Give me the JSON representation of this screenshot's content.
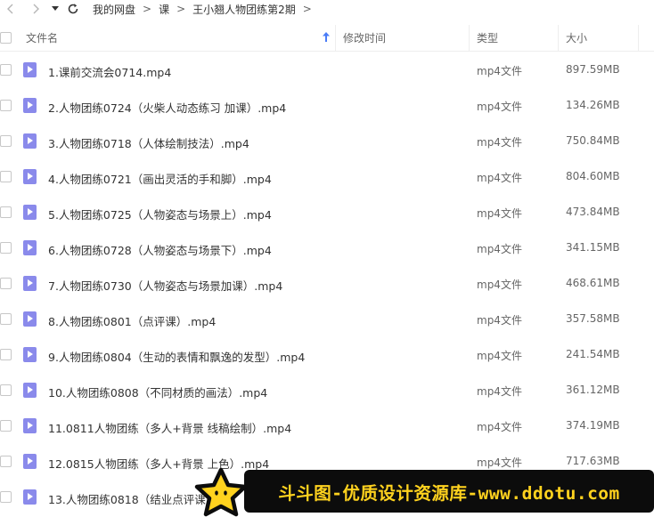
{
  "nav": {
    "back_icon": "chevron-left-icon",
    "forward_icon": "chevron-right-icon",
    "dropdown_icon": "caret-down-icon",
    "refresh_icon": "refresh-icon"
  },
  "breadcrumb": {
    "items": [
      "我的网盘",
      "课",
      "王小翘人物团练第2期"
    ],
    "separator": ">"
  },
  "table": {
    "headers": {
      "name": "文件名",
      "modified": "修改时间",
      "type": "类型",
      "size": "大小"
    },
    "sort_icon": "arrow-up-icon",
    "sort_color": "#4a7cf7",
    "file_icon_color": "#8a8aeb",
    "rows": [
      {
        "name": "1.课前交流会0714.mp4",
        "type": "mp4文件",
        "size": "897.59MB"
      },
      {
        "name": "2.人物团练0724（火柴人动态练习 加课）.mp4",
        "type": "mp4文件",
        "size": "134.26MB"
      },
      {
        "name": "3.人物团练0718（人体绘制技法）.mp4",
        "type": "mp4文件",
        "size": "750.84MB"
      },
      {
        "name": "4.人物团练0721（画出灵活的手和脚）.mp4",
        "type": "mp4文件",
        "size": "804.60MB"
      },
      {
        "name": "5.人物团练0725（人物姿态与场景上）.mp4",
        "type": "mp4文件",
        "size": "473.84MB"
      },
      {
        "name": "6.人物团练0728（人物姿态与场景下）.mp4",
        "type": "mp4文件",
        "size": "341.15MB"
      },
      {
        "name": "7.人物团练0730（人物姿态与场景加课）.mp4",
        "type": "mp4文件",
        "size": "468.61MB"
      },
      {
        "name": "8.人物团练0801（点评课）.mp4",
        "type": "mp4文件",
        "size": "357.58MB"
      },
      {
        "name": "9.人物团练0804（生动的表情和飘逸的发型）.mp4",
        "type": "mp4文件",
        "size": "241.54MB"
      },
      {
        "name": "10.人物团练0808（不同材质的画法）.mp4",
        "type": "mp4文件",
        "size": "361.12MB"
      },
      {
        "name": "11.0811人物团练（多人+背景 线稿绘制）.mp4",
        "type": "mp4文件",
        "size": "374.19MB"
      },
      {
        "name": "12.0815人物团练（多人+背景 上色）.mp4",
        "type": "mp4文件",
        "size": "717.63MB"
      },
      {
        "name": "13.人物团练0818（结业点评课）",
        "type": "",
        "size": ""
      }
    ]
  },
  "watermark": {
    "text": "斗斗图-优质设计资源库-www.ddotu.com",
    "text_color": "#ffd21e",
    "background": "#0c0c0c",
    "star_icon": "star-icon"
  }
}
